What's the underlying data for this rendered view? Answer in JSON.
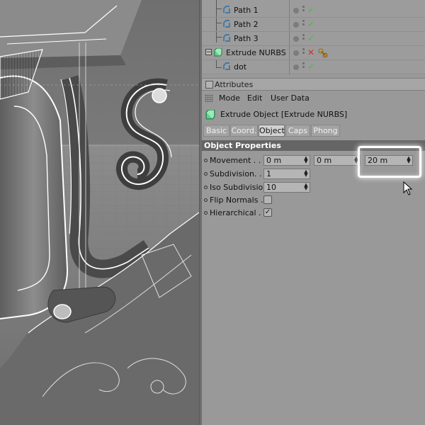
{
  "object_manager": {
    "objects": [
      {
        "name": "Path 1",
        "icon": "spline-path-icon",
        "state": "check"
      },
      {
        "name": "Path 2",
        "icon": "spline-path-icon",
        "state": "check"
      },
      {
        "name": "Path 3",
        "icon": "spline-path-icon",
        "state": "check"
      },
      {
        "name": "Extrude NURBS",
        "icon": "extrude-nurbs-icon",
        "state": "cross",
        "expanded": true
      },
      {
        "name": "dot",
        "icon": "spline-path-icon",
        "state": "check"
      }
    ],
    "check_glyph": "✓",
    "cross_glyph": "✕",
    "collapse_glyph": "−"
  },
  "attributes": {
    "panel_title": "Attributes",
    "menu": {
      "mode": "Mode",
      "edit": "Edit",
      "user_data": "User Data"
    },
    "object_title": "Extrude Object [Extrude NURBS]",
    "tabs": [
      {
        "label": "Basic",
        "active": false
      },
      {
        "label": "Coord.",
        "active": false
      },
      {
        "label": "Object",
        "active": true
      },
      {
        "label": "Caps",
        "active": false
      },
      {
        "label": "Phong",
        "active": false
      }
    ],
    "section_title": "Object Properties",
    "properties": {
      "movement": {
        "label": "Movement . . .",
        "x": "0 m",
        "y": "0 m",
        "z": "20 m"
      },
      "subdivision": {
        "label": "Subdivision. . .",
        "value": "1"
      },
      "iso_subdivision": {
        "label": "Iso Subdivision",
        "value": "10"
      },
      "flip_normals": {
        "label": "Flip Normals . .",
        "checked": false
      },
      "hierarchical": {
        "label": "Hierarchical . .",
        "checked": true
      }
    }
  },
  "colors": {
    "accent_check": "#3fbf3f",
    "accent_cross": "#d03030",
    "section_bg": "#656565",
    "highlight": "#ffffff"
  }
}
